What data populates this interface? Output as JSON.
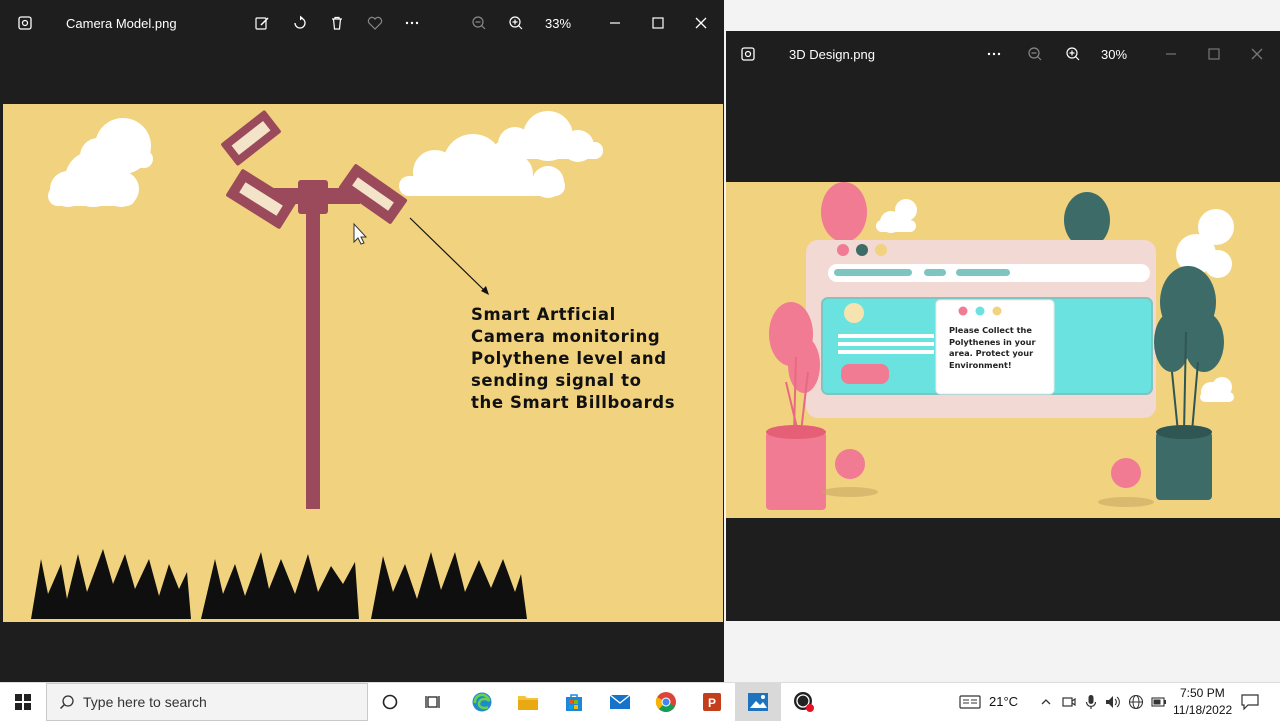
{
  "windows": [
    {
      "title": "Camera Model.png",
      "zoom": "33%",
      "image_caption": [
        "Smart Artficial",
        "Camera monitoring",
        "Polythene level and",
        "sending signal to",
        "the Smart Billboards"
      ]
    },
    {
      "title": "3D Design.png",
      "zoom": "30%",
      "popup_text": [
        "Please Collect the",
        "Polythenes in your",
        "area. Protect your",
        "Environment!"
      ]
    }
  ],
  "taskbar": {
    "search_placeholder": "Type here to search",
    "weather": "21°C",
    "time": "7:50 PM",
    "date": "11/18/2022"
  },
  "colors": {
    "image_bg": "#f1d27f",
    "camera": "#9a4a5a",
    "cloud": "#ffffff",
    "teal": "#3c6b68",
    "pink": "#f07b92",
    "cyan": "#6ae3e0"
  }
}
